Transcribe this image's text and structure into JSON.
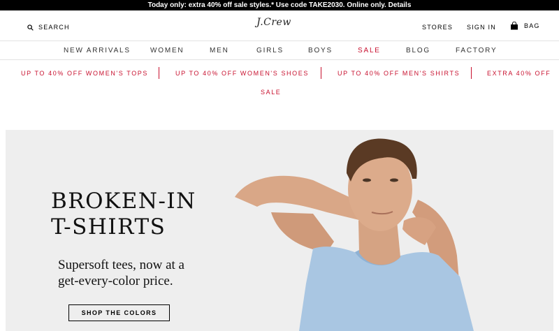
{
  "promo": {
    "text": "Today only: extra 40% off sale styles.* Use code TAKE2030. Online only. Details"
  },
  "header": {
    "search_label": "SEARCH",
    "logo_text": "J.Crew",
    "stores_label": "STORES",
    "signin_label": "SIGN IN",
    "bag_label": "BAG"
  },
  "nav": {
    "items": [
      {
        "label": "NEW ARRIVALS"
      },
      {
        "label": "WOMEN"
      },
      {
        "label": "MEN"
      },
      {
        "label": "GIRLS"
      },
      {
        "label": "BOYS"
      },
      {
        "label": "SALE"
      },
      {
        "label": "BLOG"
      },
      {
        "label": "FACTORY"
      }
    ],
    "sale_color": "#c8102e"
  },
  "offers": {
    "items": [
      {
        "label": "UP TO 40% OFF WOMEN'S TOPS"
      },
      {
        "label": "UP TO 40% OFF WOMEN'S SHOES"
      },
      {
        "label": "UP TO 40% OFF MEN'S SHIRTS"
      },
      {
        "label": "EXTRA 40% OFF"
      }
    ],
    "wrap_label": "SALE"
  },
  "hero": {
    "title_line1": "BROKEN-IN",
    "title_line2": "T-SHIRTS",
    "subtitle_line1": "Supersoft tees, now at a",
    "subtitle_line2": "get-every-color price.",
    "cta_label": "SHOP THE COLORS",
    "background_color": "#eeeeee"
  },
  "icons": [
    "search-icon",
    "bag-icon"
  ]
}
